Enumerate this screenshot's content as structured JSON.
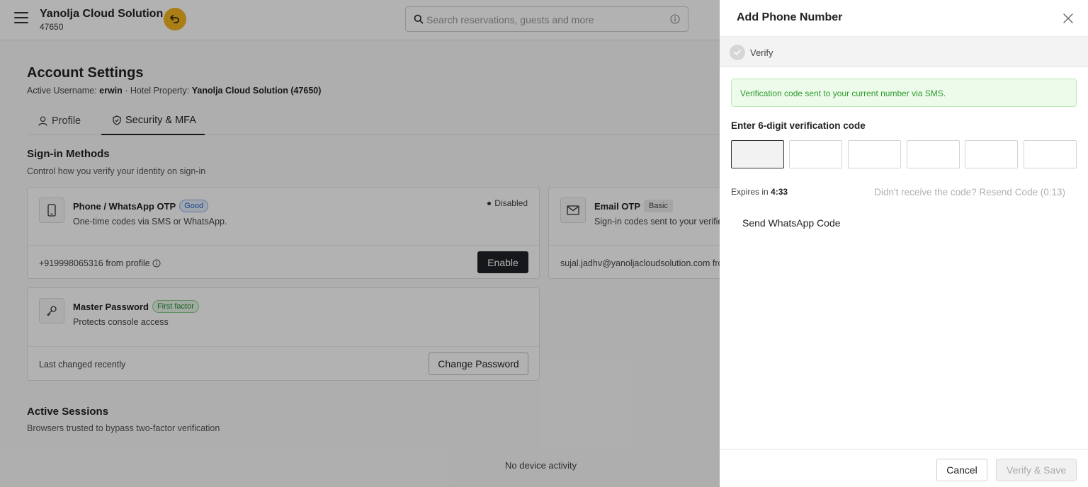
{
  "header": {
    "brand_name": "Yanolja Cloud Solution",
    "brand_id": "47650",
    "search_placeholder": "Search reservations, guests and more",
    "icons": [
      "menu-icon",
      "back-icon",
      "search-icon",
      "info-icon"
    ]
  },
  "page": {
    "title": "Account Settings",
    "sub_prefix": "Active Username: ",
    "username": "erwin",
    "sub_mid": " · Hotel Property: ",
    "property": "Yanolja Cloud Solution (47650)"
  },
  "tabs": [
    {
      "label": "Profile",
      "icon": "user-icon"
    },
    {
      "label": "Security & MFA",
      "icon": "shield-icon",
      "active": true
    }
  ],
  "signin": {
    "title": "Sign-in Methods",
    "subtitle": "Control how you verify your identity on sign-in",
    "phone": {
      "title": "Phone / WhatsApp OTP",
      "badge": "Good",
      "desc": "One-time codes via SMS or WhatsApp.",
      "status": "Disabled",
      "footer": "+919998065316 from profile",
      "button": "Enable",
      "icon": "phone-icon"
    },
    "email": {
      "title": "Email OTP",
      "badge": "Basic",
      "desc": "Sign-in codes sent to your verified email.",
      "footer": "sujal.jadhv@yanoljacloudsolution.com from profile",
      "icon": "mail-icon"
    },
    "password": {
      "title": "Master Password",
      "badge": "First factor",
      "desc": "Protects console access",
      "footer": "Last changed recently",
      "button": "Change Password",
      "icon": "key-icon"
    }
  },
  "sessions": {
    "title": "Active Sessions",
    "subtitle": "Browsers trusted to bypass two-factor verification",
    "empty": "No device activity"
  },
  "drawer": {
    "title": "Add Phone Number",
    "step_label": "Verify",
    "alert": "Verification code sent to your current number via SMS.",
    "code_label": "Enter 6-digit verification code",
    "otp_values": [
      "",
      "",
      "",
      "",
      "",
      ""
    ],
    "expires_label": "Expires in ",
    "expires_time": "4:33",
    "resend": "Didn't receive the code? Resend Code (0:13)",
    "whatsapp_button": "Send WhatsApp Code",
    "cancel_button": "Cancel",
    "verify_button": "Verify & Save",
    "colors": {
      "alert_text": "#2e9a2e",
      "alert_bg": "#edfbea",
      "accent_yellow": "#f2b51d"
    }
  }
}
